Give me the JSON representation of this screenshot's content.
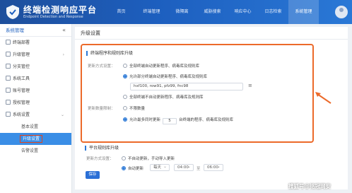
{
  "header": {
    "title": "终端检测响应平台",
    "subtitle": "Endpoint Detection and Response",
    "nav": [
      "首页",
      "终端管理",
      "微隔离",
      "威胁搜索",
      "响应中心",
      "日志检索",
      "系统管理"
    ]
  },
  "sidebar": {
    "title": "系统管理",
    "collapse_label": "«",
    "items": [
      {
        "label": "终端部署",
        "icon": "deploy-icon"
      },
      {
        "label": "升级管理",
        "icon": "upgrade-icon",
        "arrow": "›"
      },
      {
        "label": "分支管控",
        "icon": "branch-icon"
      },
      {
        "label": "系统工具",
        "icon": "tools-icon"
      },
      {
        "label": "账号管理",
        "icon": "account-icon"
      },
      {
        "label": "授权管理",
        "icon": "license-icon"
      },
      {
        "label": "系统设置",
        "icon": "settings-icon",
        "arrow": "⌄"
      }
    ],
    "subitems": [
      "基本设置",
      "升级设置",
      "告警设置"
    ]
  },
  "main": {
    "page_title": "升级设置",
    "section1": {
      "title": "终端程序和规则库升级",
      "label_mode": "更新方式设置：",
      "options_mode": [
        "全部终端自动更新程序、病毒库及规则库",
        "允许部分终端自动更新程序、病毒库及规则库",
        "全部终端不自动更新程序、病毒库及规则库"
      ],
      "group_field_value": "hxf100, row91, pfz99, fnc98",
      "label_concurrency": "更新数量限制：",
      "option_unlimited": "不限数量",
      "concurrency_prefix": "允许最多同时更新",
      "concurrency_value": "5",
      "concurrency_suffix": "台终端的程序、病毒库及规则库"
    },
    "section2": {
      "title": "平台规则库升级",
      "label_mode": "更新方式设置：",
      "option_manual": "不自动更新，手动导入更新",
      "option_auto": "自动更新",
      "frequency": "每天",
      "time_start": "04:00",
      "time_sep": "至",
      "time_end": "06:00"
    },
    "save_label": "保存"
  },
  "watermark": "搜狐号@铭冠网安",
  "colors": {
    "header": "#1d5fbf",
    "accent": "#2a78d6",
    "highlight": "#ec6a2a"
  }
}
